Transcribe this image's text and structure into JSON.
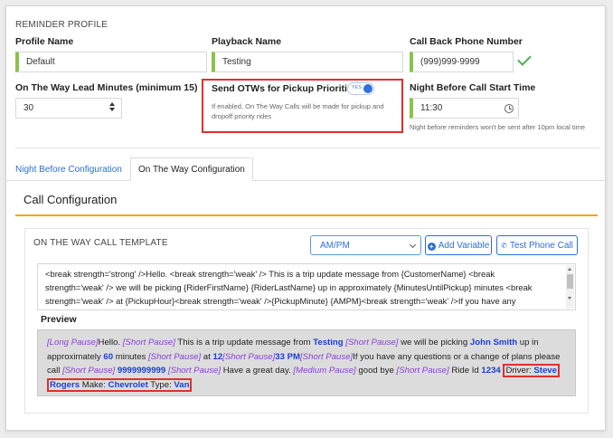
{
  "profile": {
    "section_title": "REMINDER PROFILE",
    "profile_name_label": "Profile Name",
    "profile_name_value": "Default",
    "playback_name_label": "Playback Name",
    "playback_name_value": "Testing",
    "callback_label": "Call Back Phone Number",
    "callback_value": "(999)999-9999",
    "lead_minutes_label": "On The Way Lead Minutes (minimum 15)",
    "lead_minutes_value": "30",
    "send_otw_label": "Send OTWs for Pickup Priorities",
    "toggle_text": "YES",
    "send_otw_note": "If enabled, On The Way Calls will be made for pickup and dropoff priority rides",
    "night_start_label": "Night Before Call Start Time",
    "night_start_value": "11:30",
    "night_note": "Night before reminders won't be sent after 10pm local time"
  },
  "tabs": [
    {
      "label": "Night Before Configuration"
    },
    {
      "label": "On The Way Configuration"
    }
  ],
  "call_config": {
    "title": "Call Configuration",
    "template_title": "ON THE WAY CALL TEMPLATE",
    "format_select": "AM/PM",
    "add_variable": "Add Variable",
    "test_call": "Test Phone Call",
    "template_lines": [
      "<break strength='strong' />Hello. <break strength='weak' /> This is a trip update message from {CustomerName} <break",
      "strength='weak' /> we will be picking {RiderFirstName} {RiderLastName} up in approximately {MinutesUntilPickup} minutes <break",
      "strength='weak' /> at {PickupHour}<break strength='weak' />{PickupMinute} {AMPM}<break strength='weak' />If you have any"
    ],
    "preview_label": "Preview",
    "preview": {
      "p1": "[Long Pause]",
      "t1": "Hello. ",
      "p2": "[Short Pause]",
      "t2": " This is a trip update message from ",
      "v1": "Testing",
      "t3": " ",
      "p3": "[Short Pause]",
      "t4": " we will be picking ",
      "v2": "John Smith",
      "t5": " up in",
      "t6": "approximately ",
      "v3": "60",
      "t7": " minutes ",
      "p4": "[Short Pause]",
      "t8": " at ",
      "v4": "12",
      "p5": "[Short Pause]",
      "v5": "33 PM",
      "p6": "[Short Pause]",
      "t9": "If you have any questions or a change of plans please",
      "t10": "call ",
      "p7": "[Short Pause]",
      "t11": " ",
      "v6": "9999999999",
      "t12": " ",
      "p8": "[Short Pause]",
      "t13": " Have a great day. ",
      "p9": "[Medium Pause]",
      "t14": " good bye ",
      "p10": "[Short Pause]",
      "t15": " Ride Id ",
      "v7": "1234",
      "t16": " ",
      "driver_label": "Driver: ",
      "v8": "Steve",
      "v9": "Rogers",
      "make_label": " Make: ",
      "v10": "Chevrolet",
      "type_label": " Type: ",
      "v11": "Van"
    }
  },
  "colors": {
    "accent_green": "#8bc34a",
    "link_blue": "#2b6fd6",
    "orange": "#f0a70a",
    "highlight_red": "#e0302f",
    "pause_purple": "#8a3fd6",
    "value_blue": "#1a3fd6"
  }
}
